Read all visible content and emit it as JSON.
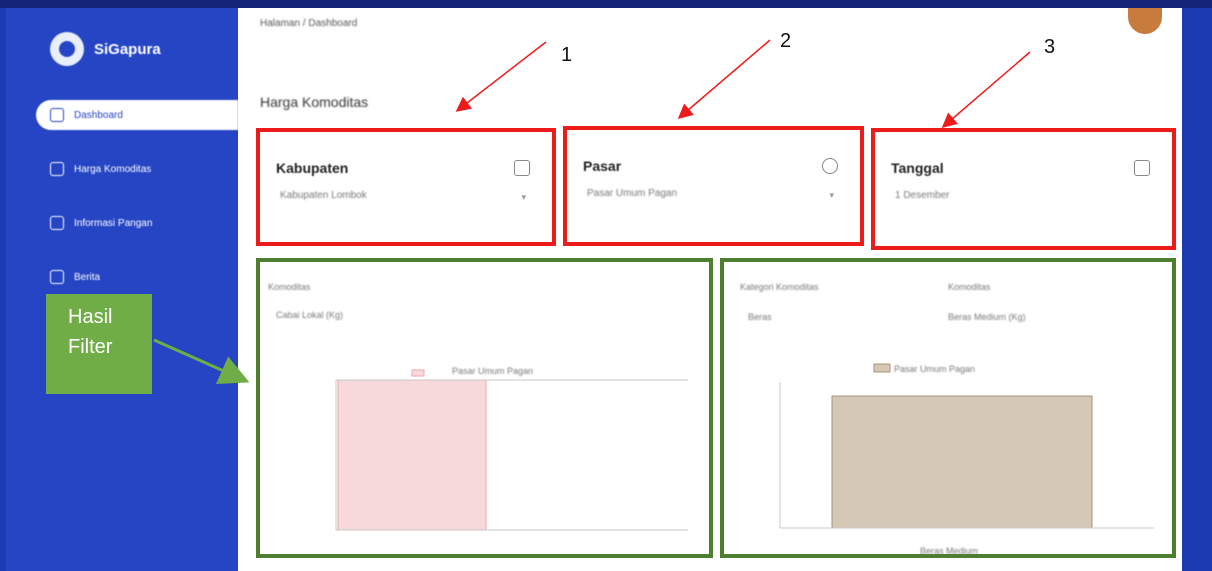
{
  "app": {
    "name": "SiGapura"
  },
  "sidebar": {
    "items": [
      {
        "label": "Dashboard",
        "active": true
      },
      {
        "label": "Harga Komoditas",
        "active": false
      },
      {
        "label": "Informasi Pangan",
        "active": false
      },
      {
        "label": "Berita",
        "active": false
      }
    ]
  },
  "breadcrumb": "Halaman / Dashboard",
  "page_title": "Harga Komoditas",
  "filters": [
    {
      "number": "1",
      "label": "Kabupaten",
      "value": "Kabupaten Lombok",
      "icon": "map-icon"
    },
    {
      "number": "2",
      "label": "Pasar",
      "value": "Pasar Umum Pagan",
      "icon": "location-icon"
    },
    {
      "number": "3",
      "label": "Tanggal",
      "value": "1 Desember",
      "icon": "calendar-icon"
    }
  ],
  "callout": {
    "line1": "Hasil",
    "line2": "Filter"
  },
  "left_chart": {
    "dropdown_label": "Komoditas",
    "dropdown_value": "Cabai Lokal (Kg)",
    "legend": "Pasar Umum Pagan"
  },
  "right_chart": {
    "dropdown1_label": "Kategori Komoditas",
    "dropdown1_value": "Beras",
    "dropdown2_label": "Komoditas",
    "dropdown2_value": "Beras Medium (Kg)",
    "legend": "Pasar Umum Pagan",
    "category": "Beras Medium"
  },
  "colors": {
    "sidebar": "#2545c4",
    "frame": "#1c3bb3",
    "highlight_red": "#ee1b1b",
    "highlight_green": "#4e7f31",
    "callout_green": "#70ad47",
    "arrow_green": "#70ad47"
  }
}
